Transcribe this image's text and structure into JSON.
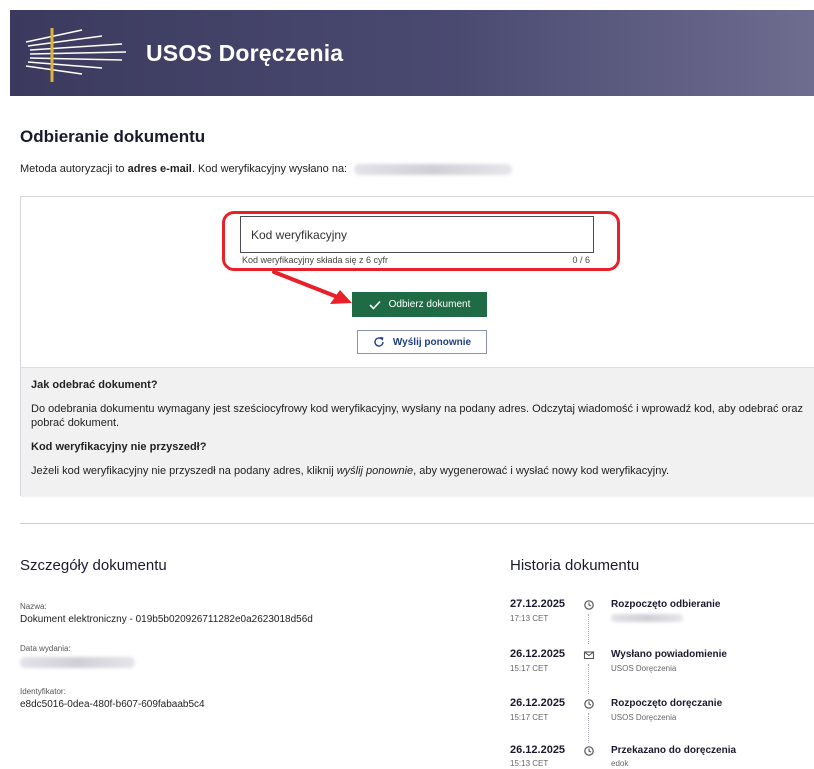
{
  "header": {
    "title": "USOS Doręczenia"
  },
  "page": {
    "title": "Odbieranie dokumentu",
    "method_prefix": "Metoda autoryzacji to ",
    "method_bold": "adres e-mail",
    "method_suffix": ". Kod weryfikacyjny wysłano na:"
  },
  "form": {
    "code_placeholder": "Kod weryfikacyjny",
    "code_value": "",
    "hint": "Kod weryfikacyjny składa się z 6 cyfr",
    "counter": "0 / 6",
    "submit_label": "Odbierz dokument",
    "resend_label": "Wyślij ponownie"
  },
  "info": {
    "q1": "Jak odebrać dokument?",
    "a1": "Do odebrania dokumentu wymagany jest sześciocyfrowy kod weryfikacyjny, wysłany na podany adres. Odczytaj wiadomość i wprowadź kod, aby odebrać oraz pobrać dokument.",
    "q2": "Kod weryfikacyjny nie przyszedł?",
    "a2_prefix": "Jeżeli kod weryfikacyjny nie przyszedł na podany adres, kliknij ",
    "a2_italic": "wyślij ponownie",
    "a2_suffix": ", aby wygenerować i wysłać nowy kod weryfikacyjny."
  },
  "details": {
    "title": "Szczegóły dokumentu",
    "name_label": "Nazwa:",
    "name_value": "Dokument elektroniczny - 019b5b020926711282e0a2623018d56d",
    "date_label": "Data wydania:",
    "id_label": "Identyfikator:",
    "id_value": "e8dc5016-0dea-480f-b607-609fabaab5c4"
  },
  "history": {
    "title": "Historia dokumentu",
    "items": [
      {
        "date": "27.12.2025",
        "time": "17:13 CET",
        "event": "Rozpoczęto odbieranie",
        "source": "",
        "icon": "clock-icon"
      },
      {
        "date": "26.12.2025",
        "time": "15:17 CET",
        "event": "Wysłano powiadomienie",
        "source": "USOS Doręczenia",
        "icon": "envelope-icon"
      },
      {
        "date": "26.12.2025",
        "time": "15:17 CET",
        "event": "Rozpoczęto doręczanie",
        "source": "USOS Doręczenia",
        "icon": "clock-icon"
      },
      {
        "date": "26.12.2025",
        "time": "15:13 CET",
        "event": "Przekazano do doręczenia",
        "source": "edok",
        "icon": "clock-icon"
      }
    ]
  },
  "colors": {
    "header": "#3b3a5e",
    "primary_button": "#1f6b45",
    "highlight": "#e8202a",
    "link": "#1f3e85"
  }
}
